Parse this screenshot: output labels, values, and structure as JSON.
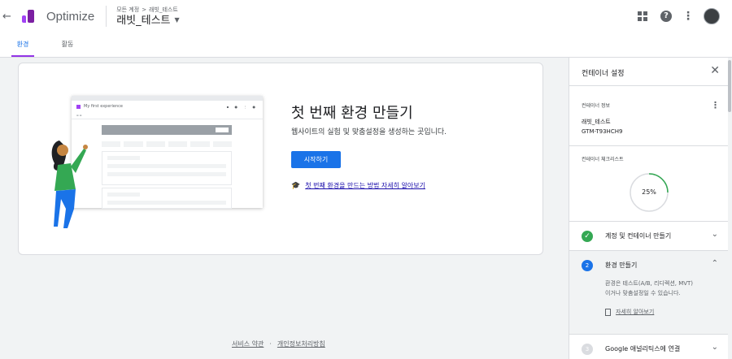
{
  "header": {
    "back_icon": "arrow-back-icon",
    "app_name": "Optimize",
    "breadcrumb": [
      "모든 계정",
      "래빗_테스트"
    ],
    "breadcrumb_sep": ">",
    "container_name": "래빗_테스트"
  },
  "tabs": [
    {
      "label": "환경",
      "active": true
    },
    {
      "label": "활동",
      "active": false
    }
  ],
  "card": {
    "mock_title": "My first experience",
    "title": "첫 번째 환경 만들기",
    "subtitle": "웹사이트의 실험 및 맞춤설정을 생성하는 곳입니다.",
    "start_button": "시작하기",
    "learn_link": "첫 번째 환경을 만드는 방법 자세히 알아보기"
  },
  "footer": {
    "terms": "서비스 약관",
    "dot": "·",
    "privacy": "개인정보처리방침"
  },
  "panel": {
    "title": "컨테이너 설정",
    "info_label": "컨테이너 정보",
    "container_name": "래빗_테스트",
    "container_id": "GTM-T93HCH9",
    "checklist_label": "컨테이너 체크리스트",
    "progress_text": "25%",
    "progress": 0.25,
    "steps": [
      {
        "num": "✓",
        "label": "계정 및 컨테이너 만들기",
        "state": "done",
        "chevron": "⌄"
      },
      {
        "num": "2",
        "label": "환경 만들기",
        "state": "current",
        "chevron": "⌃",
        "desc": "환경은 테스트(A/B, 리디렉션, MVT)이거나 맞춤설정일 수 있습니다.",
        "link": "자세히 알아보기"
      },
      {
        "num": "3",
        "label": "Google 애널리틱스에 연결",
        "state": "todo",
        "chevron": "⌄"
      }
    ]
  },
  "colors": {
    "primary": "#1a73e8",
    "done": "#34a853",
    "inactive": "#dadce0",
    "tab_underline": "#9334e6"
  }
}
